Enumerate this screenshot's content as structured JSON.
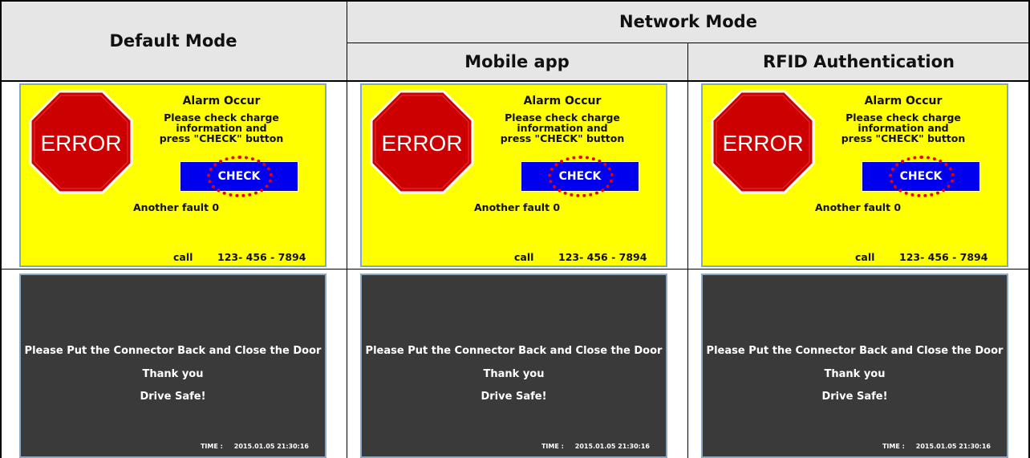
{
  "header": {
    "default_mode": "Default Mode",
    "network_mode": "Network Mode",
    "mobile_app": "Mobile app",
    "rfid": "RFID Authentication"
  },
  "columns": [
    {
      "error_screen": {
        "stop_sign_text": "ERROR",
        "title": "Alarm Occur",
        "message_line1": "Please check charge",
        "message_line2": "information and",
        "message_line3": "press \"CHECK\" button",
        "check_button": "CHECK",
        "another_fault": "Another fault 0",
        "call_label": "call",
        "phone": "123- 456 - 7894"
      },
      "door_screen": {
        "line1": "Please Put the Connector Back and Close the Door",
        "line2": "Thank you",
        "line3": "Drive  Safe!",
        "time_label": "TIME :",
        "time_value": "2015.01.05 21:30:16"
      }
    },
    {
      "error_screen": {
        "stop_sign_text": "ERROR",
        "title": "Alarm Occur",
        "message_line1": "Please check charge",
        "message_line2": "information and",
        "message_line3": "press \"CHECK\" button",
        "check_button": "CHECK",
        "another_fault": "Another fault 0",
        "call_label": "call",
        "phone": "123- 456 - 7894"
      },
      "door_screen": {
        "line1": "Please Put the Connector Back and Close the Door",
        "line2": "Thank you",
        "line3": "Drive  Safe!",
        "time_label": "TIME :",
        "time_value": "2015.01.05 21:30:16"
      }
    },
    {
      "error_screen": {
        "stop_sign_text": "ERROR",
        "title": "Alarm Occur",
        "message_line1": "Please check charge",
        "message_line2": "information and",
        "message_line3": "press \"CHECK\" button",
        "check_button": "CHECK",
        "another_fault": "Another fault 0",
        "call_label": "call",
        "phone": "123- 456 - 7894"
      },
      "door_screen": {
        "line1": "Please Put the Connector Back and Close the Door",
        "line2": "Thank you",
        "line3": "Drive  Safe!",
        "time_label": "TIME :",
        "time_value": "2015.01.05 21:30:16"
      }
    }
  ],
  "colors": {
    "header_bg": "#e6e6e6",
    "error_bg": "#ffff00",
    "check_button": "#0000ee",
    "highlight_ring": "#ee0000",
    "door_bg": "#3a3a3a",
    "stop_sign": "#cc0000"
  }
}
